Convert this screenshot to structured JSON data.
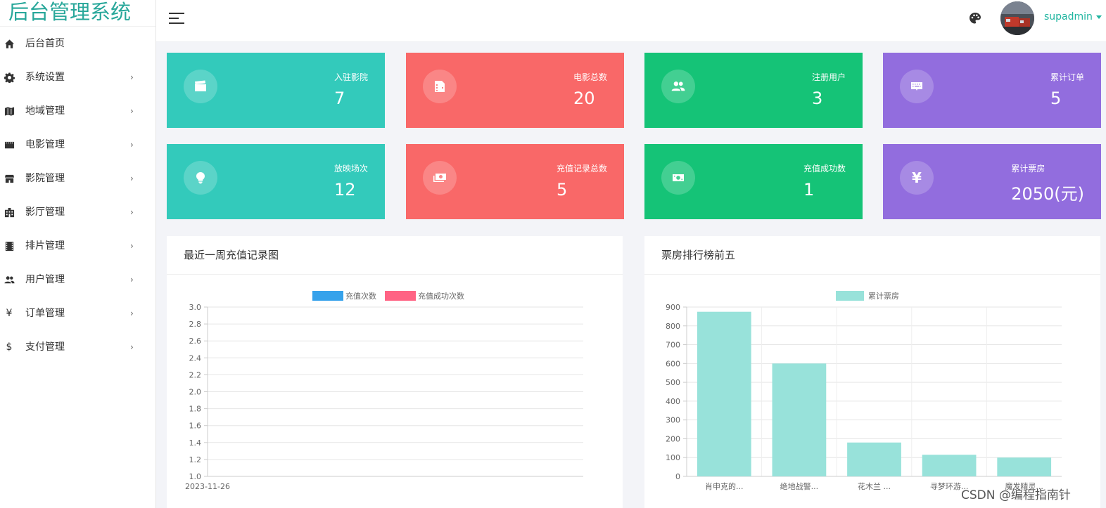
{
  "app": {
    "title": "后台管理系统"
  },
  "sidebar": {
    "items": [
      {
        "label": "后台首页",
        "icon": "home-icon",
        "has_arrow": false
      },
      {
        "label": "系统设置",
        "icon": "gear-icon",
        "has_arrow": true
      },
      {
        "label": "地域管理",
        "icon": "map-icon",
        "has_arrow": true
      },
      {
        "label": "电影管理",
        "icon": "film-icon",
        "has_arrow": true
      },
      {
        "label": "影院管理",
        "icon": "store-icon",
        "has_arrow": true
      },
      {
        "label": "影厅管理",
        "icon": "building-icon",
        "has_arrow": true
      },
      {
        "label": "排片管理",
        "icon": "film-strip-icon",
        "has_arrow": true
      },
      {
        "label": "用户管理",
        "icon": "users-icon",
        "has_arrow": true
      },
      {
        "label": "订单管理",
        "icon": "yen-icon",
        "has_arrow": true
      },
      {
        "label": "支付管理",
        "icon": "dollar-icon",
        "has_arrow": true
      }
    ],
    "arrow_glyph": "›",
    "yen_glyph": "¥",
    "dollar_glyph": "$"
  },
  "header": {
    "username": "supadmin",
    "palette_icon": "palette-icon"
  },
  "stats": [
    {
      "label": "入驻影院",
      "value": "7",
      "color": "#33cabb",
      "icon": "clapperboard-icon"
    },
    {
      "label": "电影总数",
      "value": "20",
      "color": "#f96868",
      "icon": "film-reel-icon"
    },
    {
      "label": "注册用户",
      "value": "3",
      "color": "#15c377",
      "icon": "users-icon"
    },
    {
      "label": "累计订单",
      "value": "5",
      "color": "#926dde",
      "icon": "keyboard-icon"
    },
    {
      "label": "放映场次",
      "value": "12",
      "color": "#33cabb",
      "icon": "lightbulb-icon"
    },
    {
      "label": "充值记录总数",
      "value": "5",
      "color": "#f96868",
      "icon": "money-icon"
    },
    {
      "label": "充值成功数",
      "value": "1",
      "color": "#15c377",
      "icon": "money-icon"
    },
    {
      "label": "累计票房",
      "value": "2050(元)",
      "color": "#926dde",
      "icon": "yen-icon",
      "glyph": "¥"
    }
  ],
  "panels": {
    "recharge_title": "最近一周充值记录图",
    "boxoffice_title": "票房排行榜前五"
  },
  "chart_data": [
    {
      "type": "line",
      "x": [
        "2023-11-26"
      ],
      "series": [
        {
          "name": "充值次数",
          "values": [],
          "color": "#36a2eb"
        },
        {
          "name": "充值成功次数",
          "values": [],
          "color": "#ff6384"
        }
      ],
      "ylim": [
        1.0,
        3.0
      ],
      "yticks": [
        "3.0",
        "2.8",
        "2.6",
        "2.4",
        "2.2",
        "2.0",
        "1.8",
        "1.6",
        "1.4",
        "1.2",
        "1.0"
      ],
      "legend": "top",
      "grid": true
    },
    {
      "type": "bar",
      "categories": [
        "肖申克的...",
        "绝地战警...",
        "花木兰 ...",
        "寻梦环游...",
        "魔发精灵..."
      ],
      "series": [
        {
          "name": "累计票房",
          "values": [
            875,
            600,
            180,
            115,
            100
          ],
          "color": "#98e2da"
        }
      ],
      "ylim": [
        0,
        900
      ],
      "yticks": [
        "900",
        "800",
        "700",
        "600",
        "500",
        "400",
        "300",
        "200",
        "100",
        "0"
      ],
      "legend": "top",
      "grid": true
    }
  ],
  "watermark": "CSDN @编程指南针"
}
